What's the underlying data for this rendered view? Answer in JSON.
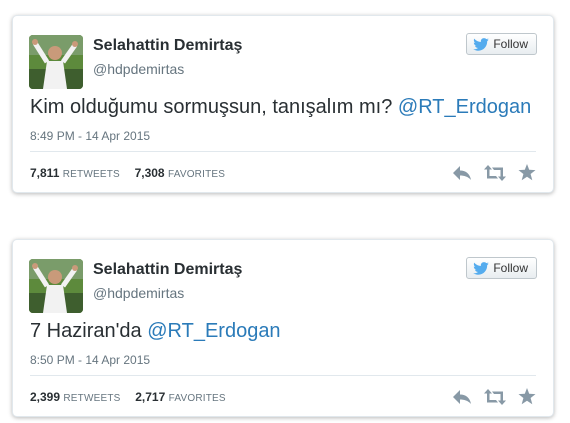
{
  "tweets": [
    {
      "name": "Selahattin Demirtaş",
      "handle": "@hdpdemirtas",
      "follow_label": "Follow",
      "text": "Kim olduğumu sormuşsun, tanışalım mı? ",
      "mention": "@RT_Erdogan",
      "timestamp": "8:49 PM - 14 Apr 2015",
      "retweets": "7,811",
      "retweets_label": "RETWEETS",
      "favorites": "7,308",
      "favorites_label": "FAVORITES"
    },
    {
      "name": "Selahattin Demirtaş",
      "handle": "@hdpdemirtas",
      "follow_label": "Follow",
      "text": "7 Haziran'da ",
      "mention": "@RT_Erdogan",
      "timestamp": "8:50 PM - 14 Apr 2015",
      "retweets": "2,399",
      "retweets_label": "RETWEETS",
      "favorites": "2,717",
      "favorites_label": "FAVORITES"
    }
  ],
  "icons": {
    "follow": "twitter-bird-icon",
    "reply": "reply-icon",
    "retweet": "retweet-icon",
    "favorite": "star-icon"
  },
  "colors": {
    "mention": "#2b7bb9",
    "bird": "#55acee",
    "action_icons": "#8899a6"
  }
}
